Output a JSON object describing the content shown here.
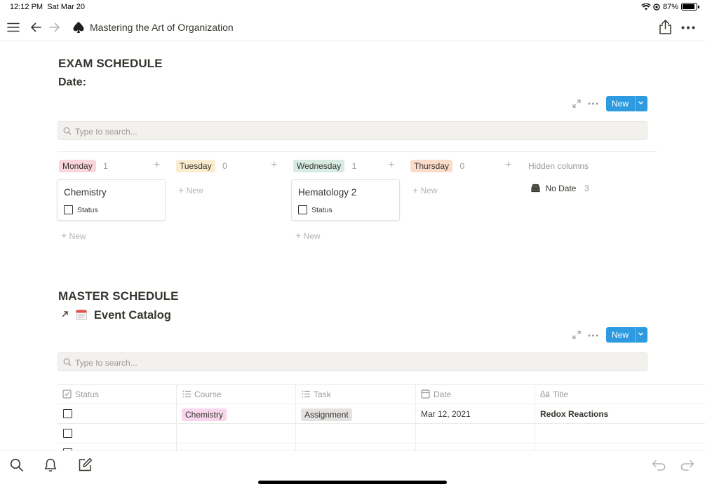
{
  "status_bar": {
    "time": "12:12 PM",
    "date": "Sat Mar 20",
    "battery": "87%",
    "battery_level": 0.87
  },
  "topbar": {
    "page_title": "Mastering the Art of Organization"
  },
  "exam_section": {
    "heading": "EXAM SCHEDULE",
    "subheading": "Date:",
    "new_label": "New",
    "search_placeholder": "Type to search...",
    "columns": [
      {
        "name": "Monday",
        "count": "1",
        "color": "#fbd5dc"
      },
      {
        "name": "Tuesday",
        "count": "0",
        "color": "#fbecd0"
      },
      {
        "name": "Wednesday",
        "count": "1",
        "color": "#d7ebe3"
      },
      {
        "name": "Thursday",
        "count": "0",
        "color": "#fbdcca"
      }
    ],
    "hidden_columns_label": "Hidden columns",
    "hidden": {
      "label": "No Date",
      "count": "3"
    },
    "cards": [
      {
        "title": "Chemistry",
        "property": "Status"
      },
      {
        "title": "Hematology 2",
        "property": "Status"
      }
    ],
    "new_item_label": "New"
  },
  "master_section": {
    "heading": "MASTER SCHEDULE",
    "link_title": "Event Catalog",
    "new_label": "New",
    "search_placeholder": "Type to search...",
    "columns": [
      "Status",
      "Course",
      "Task",
      "Date",
      "Title"
    ],
    "rows": [
      {
        "course": "Chemistry",
        "course_color": "#f8d6ec",
        "task": "Assignment",
        "task_color": "#e3e2e0",
        "date": "Mar 12, 2021",
        "title": "Redox Reactions"
      },
      {
        "course": "",
        "task": "",
        "date": "",
        "title": ""
      }
    ]
  }
}
